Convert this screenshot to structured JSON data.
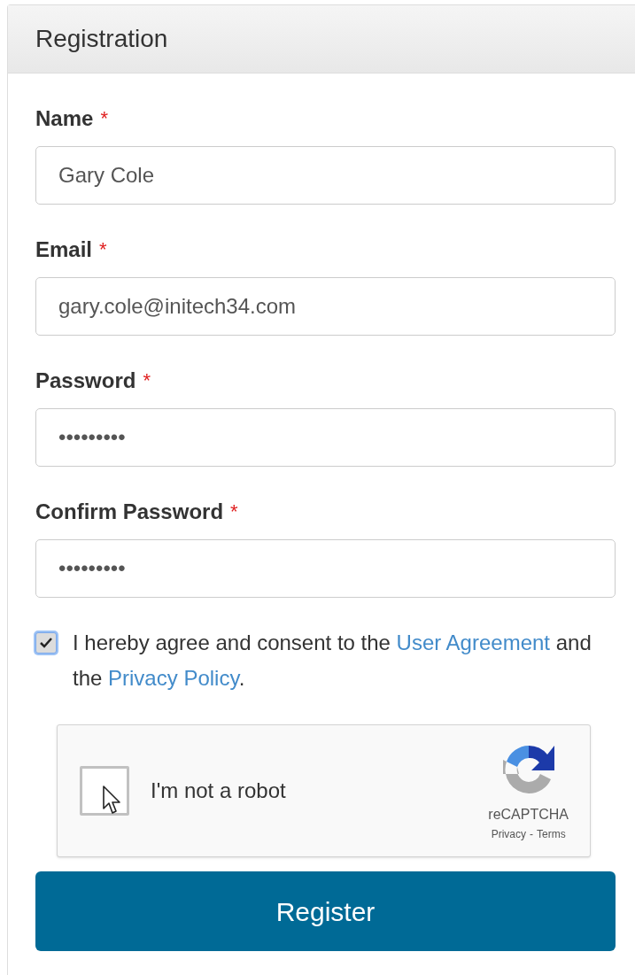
{
  "panel": {
    "title": "Registration"
  },
  "fields": [
    {
      "label": "Name",
      "required_mark": "*",
      "value": "Gary Cole"
    },
    {
      "label": "Email",
      "required_mark": "*",
      "value": "gary.cole@initech34.com"
    },
    {
      "label": "Password",
      "required_mark": "*",
      "value": "•••••••••"
    },
    {
      "label": "Confirm Password",
      "required_mark": "*",
      "value": "•••••••••"
    }
  ],
  "agreement": {
    "checked": true,
    "parts": [
      {
        "kind": "text",
        "text": "I hereby agree and consent to the "
      },
      {
        "kind": "link",
        "text": "User Agreement"
      },
      {
        "kind": "text",
        "text": " and the "
      },
      {
        "kind": "link",
        "text": "Privacy Policy"
      },
      {
        "kind": "text",
        "text": "."
      }
    ]
  },
  "captcha": {
    "checked": false,
    "label": "I'm not a robot",
    "brand": "reCAPTCHA",
    "links": [
      "Privacy",
      "Terms"
    ],
    "separator": "-"
  },
  "submit": {
    "label": "Register"
  }
}
